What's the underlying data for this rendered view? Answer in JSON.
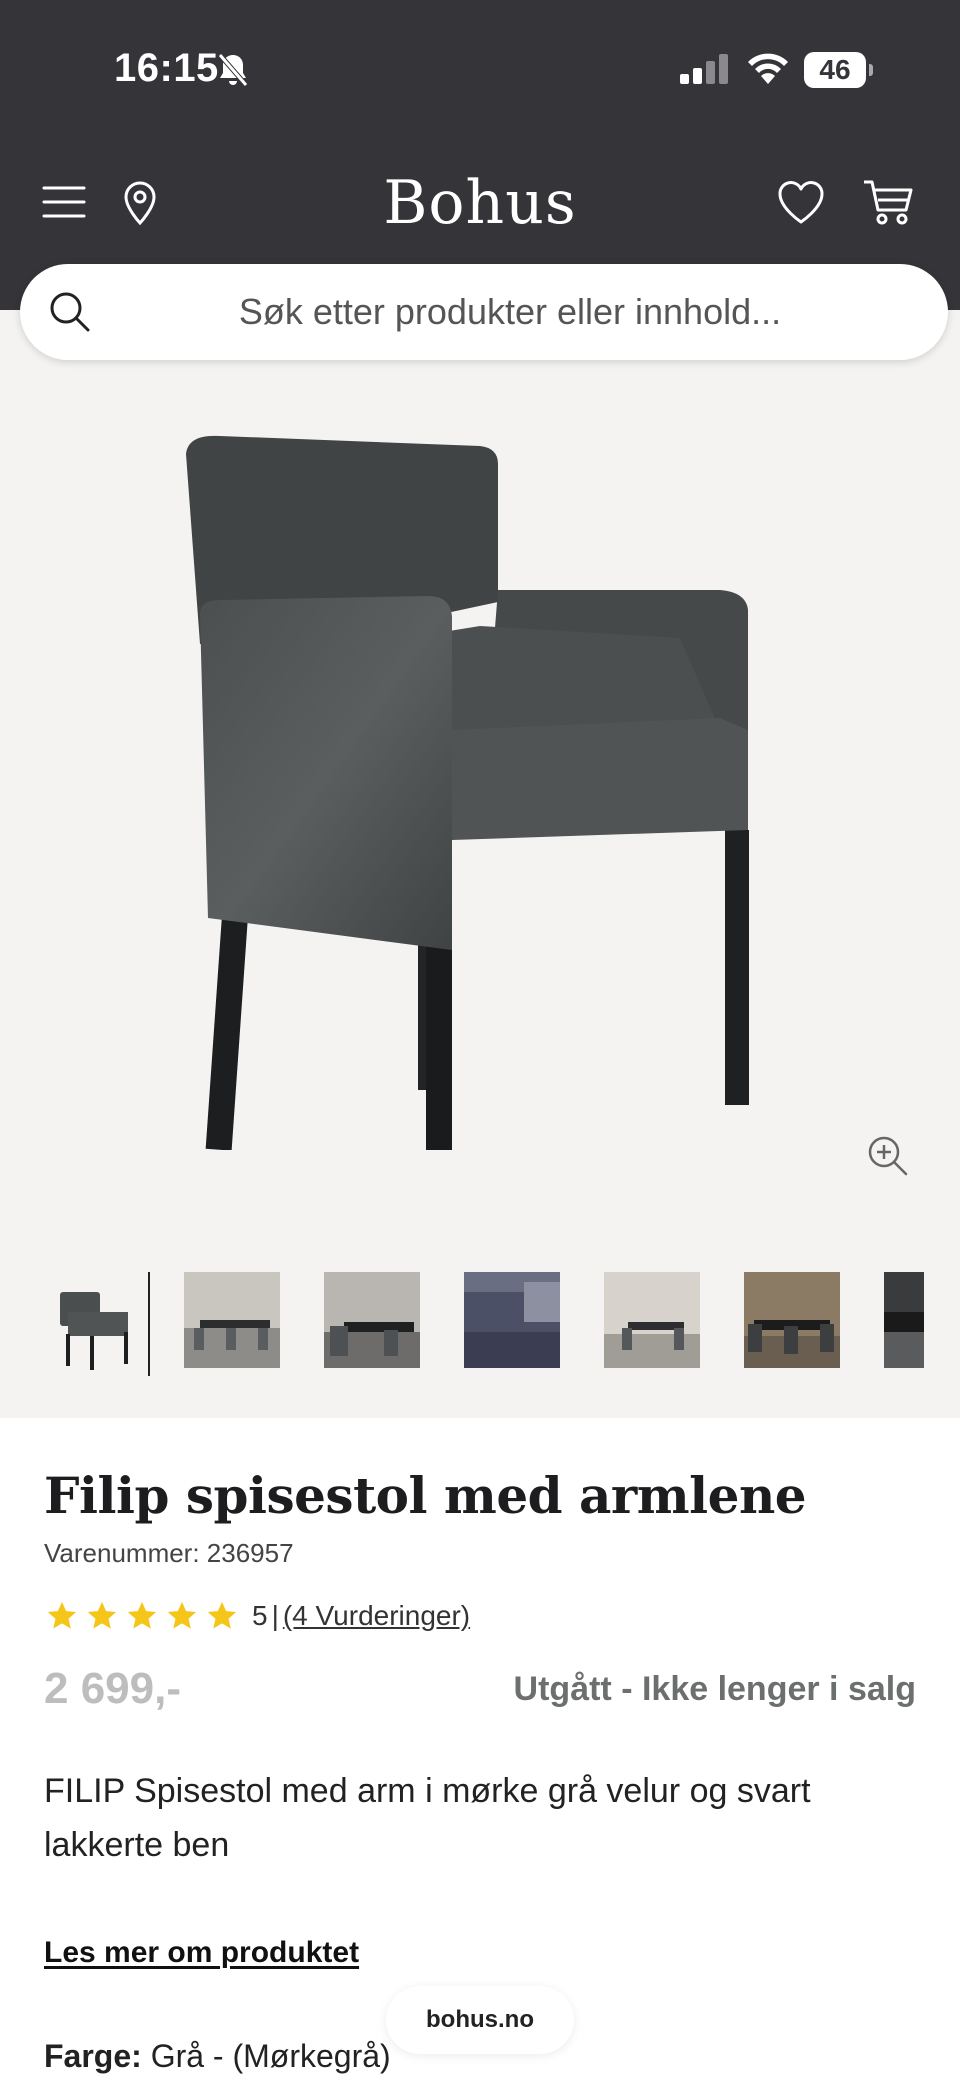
{
  "status_bar": {
    "time": "16:15",
    "battery": "46"
  },
  "header": {
    "logo": "Bohus"
  },
  "search": {
    "placeholder": "Søk etter produkter eller innhold..."
  },
  "gallery": {
    "thumbnail_count": 7
  },
  "product": {
    "title": "Filip spisestol med armlene",
    "sku": "Varenummer: 236957",
    "rating_value": "5",
    "rating_separator": "|",
    "reviews_link": "(4 Vurderinger)",
    "rating_stars": 5,
    "price": "2 699,-",
    "availability": "Utgått - Ikke lenger i salg",
    "description": "FILIP Spisestol med arm i mørke grå velur og svart lakkerte ben",
    "read_more": "Les mer om produktet",
    "color_label": "Farge:",
    "color_value": "Grå - (Mørkegrå)"
  },
  "footer": {
    "site": "bohus.no"
  },
  "colors": {
    "header_bg": "#353539",
    "gallery_bg": "#f4f3f1",
    "price": "#bdbdbd",
    "star": "#f5c518"
  }
}
